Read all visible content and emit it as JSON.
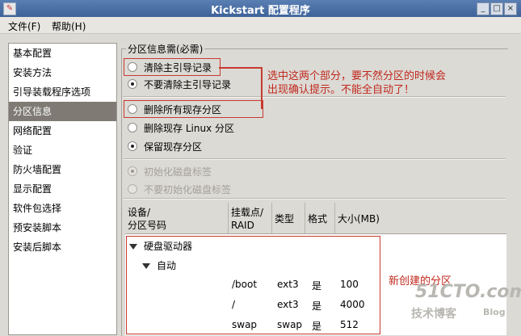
{
  "window": {
    "title": "Kickstart 配置程序",
    "minimize": "_",
    "maximize": "□",
    "close": "×"
  },
  "menu": {
    "file": "文件(F)",
    "help": "帮助(H)"
  },
  "sidebar": {
    "items": [
      {
        "label": "基本配置"
      },
      {
        "label": "安装方法"
      },
      {
        "label": "引导装载程序选项"
      },
      {
        "label": "分区信息",
        "selected": true
      },
      {
        "label": "网络配置"
      },
      {
        "label": "验证"
      },
      {
        "label": "防火墙配置"
      },
      {
        "label": "显示配置"
      },
      {
        "label": "软件包选择"
      },
      {
        "label": "预安装脚本"
      },
      {
        "label": "安装后脚本"
      }
    ]
  },
  "panel": {
    "label": "分区信息需(必需)",
    "mbr": [
      {
        "label": "清除主引导记录",
        "checked": false
      },
      {
        "label": "不要清除主引导记录",
        "checked": true
      }
    ],
    "partitions": [
      {
        "label": "删除所有现存分区",
        "checked": false
      },
      {
        "label": "删除现存 Linux 分区",
        "checked": false
      },
      {
        "label": "保留现存分区",
        "checked": true
      }
    ],
    "disklabel": [
      {
        "label": "初始化磁盘标签",
        "checked": true,
        "disabled": true
      },
      {
        "label": "不要初始化磁盘标签",
        "checked": false,
        "disabled": true
      }
    ]
  },
  "annotations": {
    "top_line1": "选中这两个部分，要不然分区的时候会",
    "top_line2": "出现确认提示。不能全自动了！",
    "table_note": "新创建的分区"
  },
  "table": {
    "headers": {
      "device_line1": "设备/",
      "device_line2": "分区号码",
      "mount_line1": "挂载点/",
      "mount_line2": "RAID",
      "type": "类型",
      "format": "格式",
      "size": "大小(MB)"
    },
    "tree": {
      "root": "硬盘驱动器",
      "child": "自动"
    },
    "rows": [
      {
        "mount": "/boot",
        "type": "ext3",
        "format": "是",
        "size": "100"
      },
      {
        "mount": "/",
        "type": "ext3",
        "format": "是",
        "size": "4000"
      },
      {
        "mount": "swap",
        "type": "swap",
        "format": "是",
        "size": "512"
      }
    ]
  },
  "watermark": {
    "line1": "51CTO.com",
    "line2": "技术博客",
    "line3": "Blog"
  }
}
